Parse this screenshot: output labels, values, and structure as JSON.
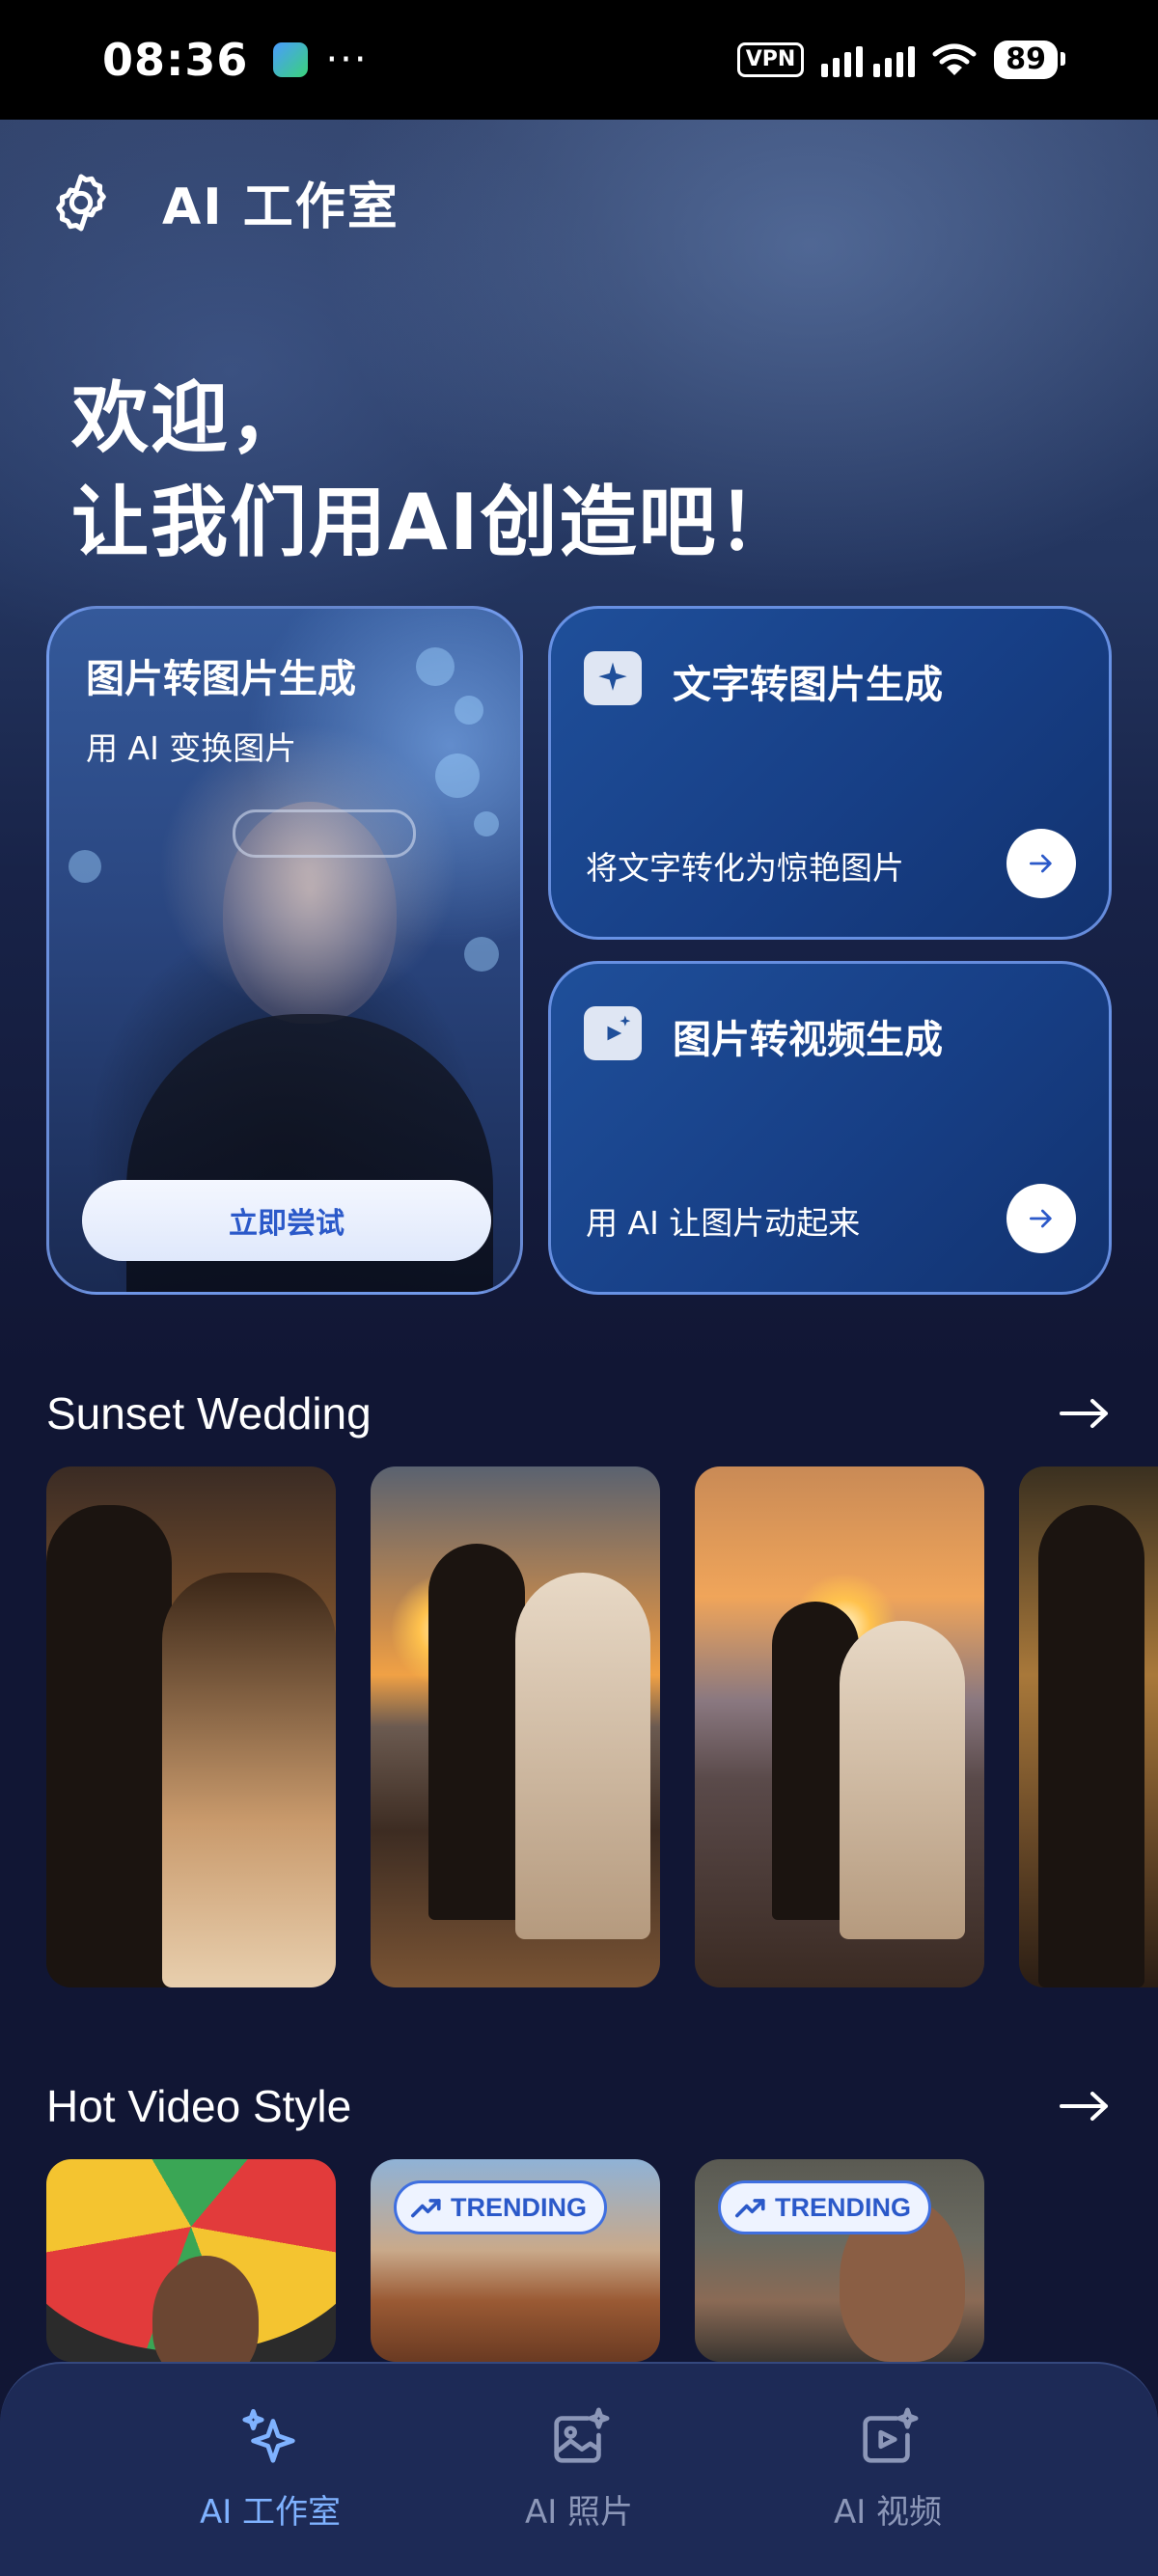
{
  "status_bar": {
    "time": "08:36",
    "dots": "···",
    "vpn": "VPN",
    "battery": "89"
  },
  "header": {
    "title": "AI 工作室",
    "settings_icon": "gear-icon"
  },
  "welcome": {
    "line1": "欢迎，",
    "line2": "让我们用AI创造吧！"
  },
  "cards": {
    "image_to_image": {
      "title": "图片转图片生成",
      "subtitle": "用 AI 变换图片",
      "button": "立即尝试"
    },
    "text_to_image": {
      "title": "文字转图片生成",
      "subtitle": "将文字转化为惊艳图片",
      "icon": "sparkle-chat-icon"
    },
    "image_to_video": {
      "title": "图片转视频生成",
      "subtitle": "用 AI 让图片动起来",
      "icon": "video-sparkle-icon"
    }
  },
  "sections": {
    "sunset_wedding": {
      "title": "Sunset Wedding"
    },
    "hot_video_style": {
      "title": "Hot Video Style",
      "badge": "TRENDING"
    }
  },
  "bottom_nav": {
    "items": [
      {
        "label": "AI 工作室",
        "icon": "sparkles-icon",
        "active": true
      },
      {
        "label": "AI 照片",
        "icon": "photo-sparkle-icon",
        "active": false
      },
      {
        "label": "AI 视频",
        "icon": "video-sparkle-icon",
        "active": false
      }
    ]
  },
  "colors": {
    "background": "#111634",
    "card_blue": "#1f4f9a",
    "accent": "#2b59c9",
    "nav_active": "#7fb2ff",
    "nav_inactive": "#8c97b8"
  }
}
